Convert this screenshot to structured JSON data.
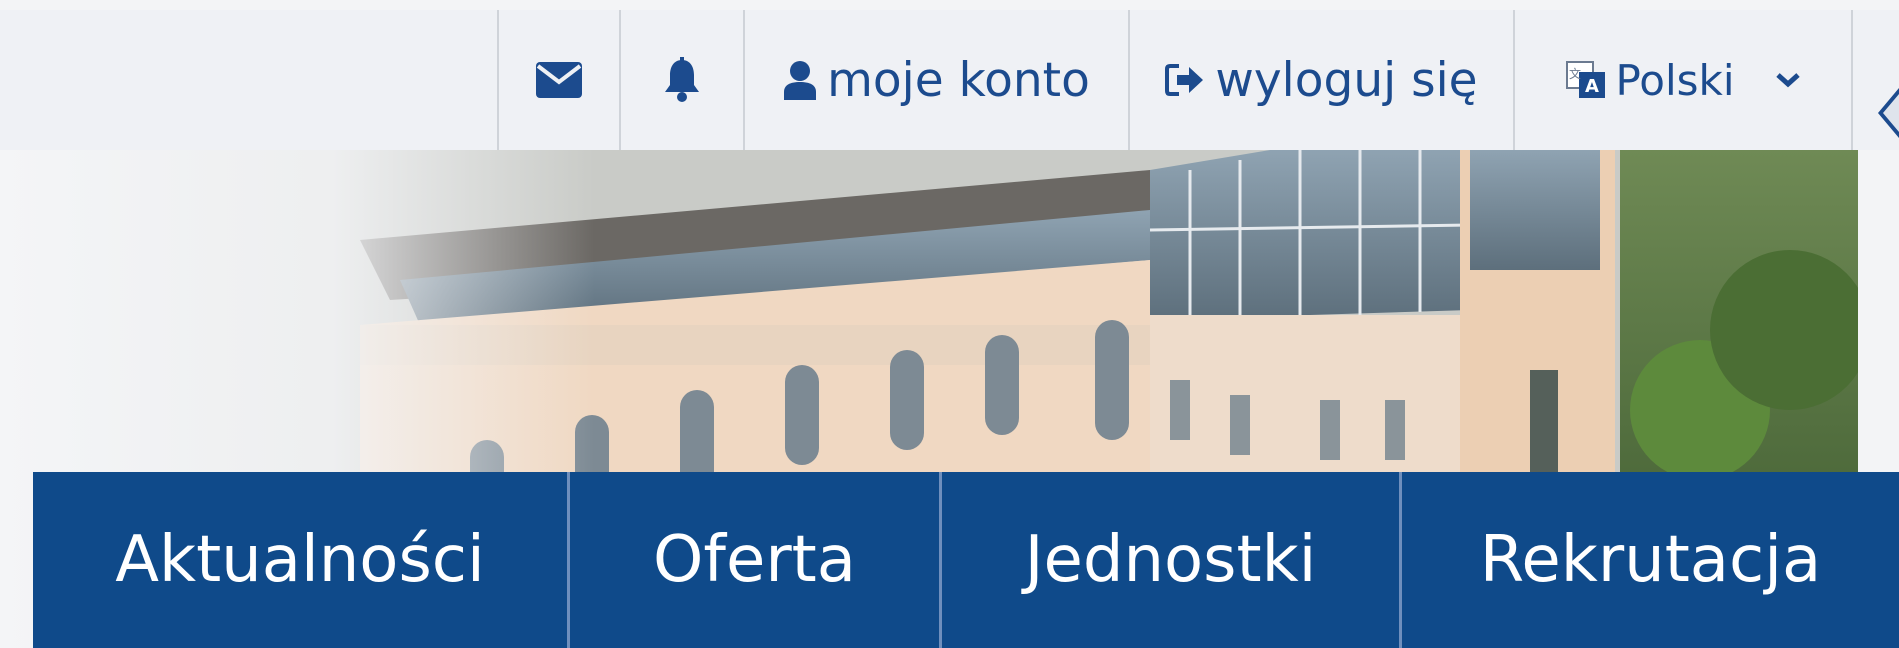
{
  "topbar": {
    "mail_icon": "envelope-icon",
    "bell_icon": "bell-icon",
    "account_icon": "user-icon",
    "account_label": "moje konto",
    "logout_icon": "sign-out-icon",
    "logout_label": "wyloguj się",
    "language_icon": "language-icon",
    "language_label": "Polski",
    "language_chevron": "chevron-down-icon"
  },
  "nav": {
    "items": [
      {
        "label": "Aktualności"
      },
      {
        "label": "Oferta"
      },
      {
        "label": "Jednostki"
      },
      {
        "label": "Rekrutacja"
      }
    ]
  },
  "colors": {
    "primary": "#0f4a8a",
    "topbar_bg": "#eff1f5",
    "icon": "#1c4b8e"
  }
}
